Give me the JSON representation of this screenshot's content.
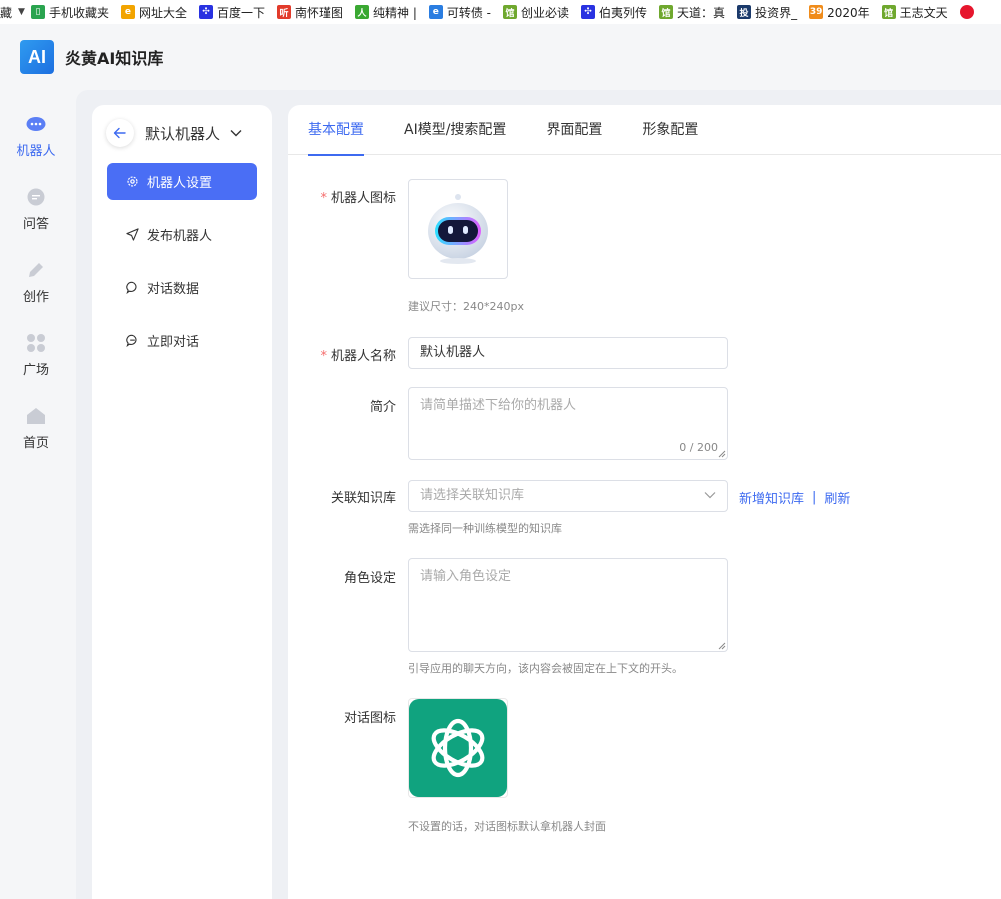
{
  "bookmarks": {
    "lead": "藏",
    "items": [
      {
        "label": "手机收藏夹",
        "icon": "mobile-icon",
        "color": "#2aa44f"
      },
      {
        "label": "网址大全",
        "icon": "globe-icon",
        "color": "#f2a400"
      },
      {
        "label": "百度一下",
        "icon": "baidu-paw-icon",
        "color": "#2932e1"
      },
      {
        "label": "南怀瑾图",
        "icon": "listen-icon",
        "color": "#e23b2b"
      },
      {
        "label": "纯精神 |",
        "icon": "figure-icon",
        "color": "#3aa832"
      },
      {
        "label": "可转债 -",
        "icon": "e-icon",
        "color": "#2a7de1"
      },
      {
        "label": "创业必读",
        "icon": "guan-icon",
        "color": "#6fa82e"
      },
      {
        "label": "伯夷列传",
        "icon": "baidu-paw-icon",
        "color": "#2932e1"
      },
      {
        "label": "天道：真",
        "icon": "guan-icon",
        "color": "#6fa82e"
      },
      {
        "label": "投资界_",
        "icon": "tou-icon",
        "color": "#1b3a6b"
      },
      {
        "label": "2020年",
        "icon": "number-icon",
        "color": "#f08c1b"
      },
      {
        "label": "王志文天",
        "icon": "guan-icon",
        "color": "#6fa82e"
      }
    ]
  },
  "header": {
    "logo_text": "AI",
    "title": "炎黄AI知识库"
  },
  "leftnav": [
    {
      "label": "机器人",
      "icon": "robot-icon",
      "active": true
    },
    {
      "label": "问答",
      "icon": "chat-bubble-icon"
    },
    {
      "label": "创作",
      "icon": "pencil-icon"
    },
    {
      "label": "广场",
      "icon": "grid-icon"
    },
    {
      "label": "首页",
      "icon": "home-icon"
    }
  ],
  "subpanel": {
    "bot_name": "默认机器人",
    "menu": [
      {
        "label": "机器人设置",
        "icon": "gear-icon",
        "active": true
      },
      {
        "label": "发布机器人",
        "icon": "send-icon"
      },
      {
        "label": "对话数据",
        "icon": "comment-icon"
      },
      {
        "label": "立即对话",
        "icon": "dialog-icon"
      }
    ]
  },
  "tabs": [
    "基本配置",
    "AI模型/搜索配置",
    "界面配置",
    "形象配置"
  ],
  "form": {
    "required_mark": "*",
    "icon_label": "机器人图标",
    "icon_hint": "建议尺寸：240*240px",
    "name_label": "机器人名称",
    "name_value": "默认机器人",
    "intro_label": "简介",
    "intro_placeholder": "请简单描述下给你的机器人",
    "intro_counter": "0 / 200",
    "kb_label": "关联知识库",
    "kb_placeholder": "请选择关联知识库",
    "kb_add": "新增知识库",
    "kb_sep": "|",
    "kb_refresh": "刷新",
    "kb_hint": "需选择同一种训练模型的知识库",
    "role_label": "角色设定",
    "role_placeholder": "请输入角色设定",
    "role_hint": "引导应用的聊天方向，该内容会被固定在上下文的开头。",
    "chat_icon_label": "对话图标",
    "chat_icon_hint": "不设置的话，对话图标默认拿机器人封面"
  },
  "colors": {
    "accent": "#3d6af0",
    "menu_active": "#4a6ef5",
    "openai_green": "#10a37f",
    "required": "#f56c6c"
  }
}
